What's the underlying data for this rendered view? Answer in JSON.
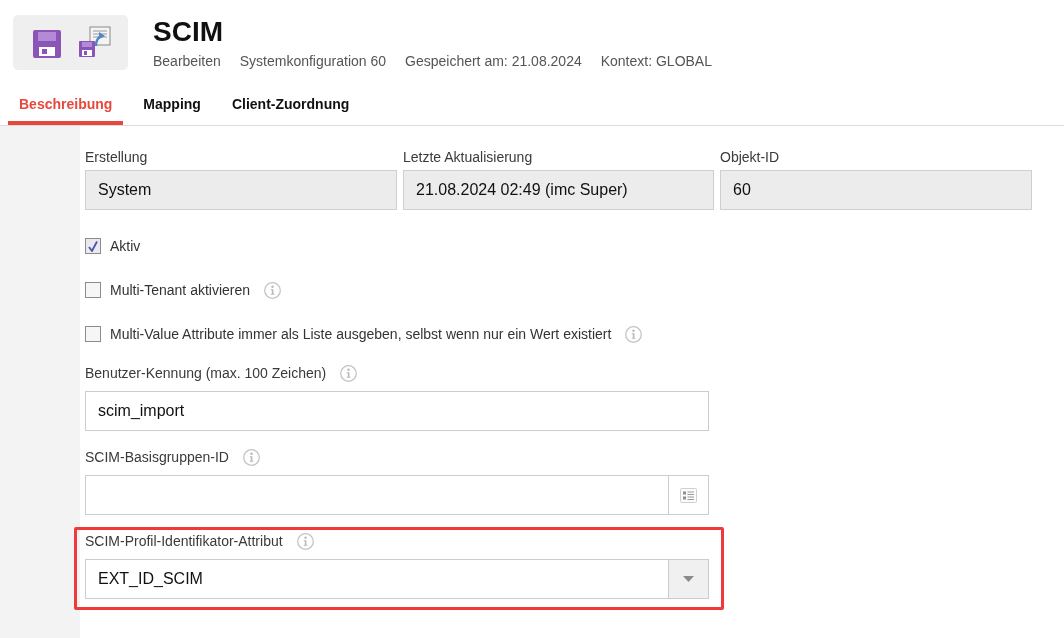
{
  "header": {
    "title": "SCIM",
    "meta": [
      "Bearbeiten",
      "Systemkonfiguration 60",
      "Gespeichert am: 21.08.2024",
      "Kontext: GLOBAL"
    ]
  },
  "tabs": [
    {
      "label": "Beschreibung",
      "selected": true
    },
    {
      "label": "Mapping",
      "selected": false
    },
    {
      "label": "Client-Zuordnung",
      "selected": false
    }
  ],
  "info_fields": [
    {
      "label": "Erstellung",
      "value": "System"
    },
    {
      "label": "Letzte Aktualisierung",
      "value": "21.08.2024 02:49 (imc Super)"
    },
    {
      "label": "Objekt-ID",
      "value": "60"
    }
  ],
  "checkboxes": [
    {
      "label": "Aktiv",
      "checked": true,
      "info": false
    },
    {
      "label": "Multi-Tenant aktivieren",
      "checked": false,
      "info": true
    },
    {
      "label": "Multi-Value Attribute immer als Liste ausgeben, selbst wenn nur ein Wert existiert",
      "checked": false,
      "info": true
    }
  ],
  "fields": [
    {
      "kind": "text",
      "label": "Benutzer-Kennung (max. 100 Zeichen)",
      "info": true,
      "value": "scim_import",
      "highlighted": false
    },
    {
      "kind": "picker",
      "label": "SCIM-Basisgruppen-ID",
      "info": true,
      "highlighted": false
    },
    {
      "kind": "select",
      "label": "SCIM-Profil-Identifikator-Attribut",
      "info": true,
      "value": "EXT_ID_SCIM",
      "highlighted": true
    }
  ]
}
